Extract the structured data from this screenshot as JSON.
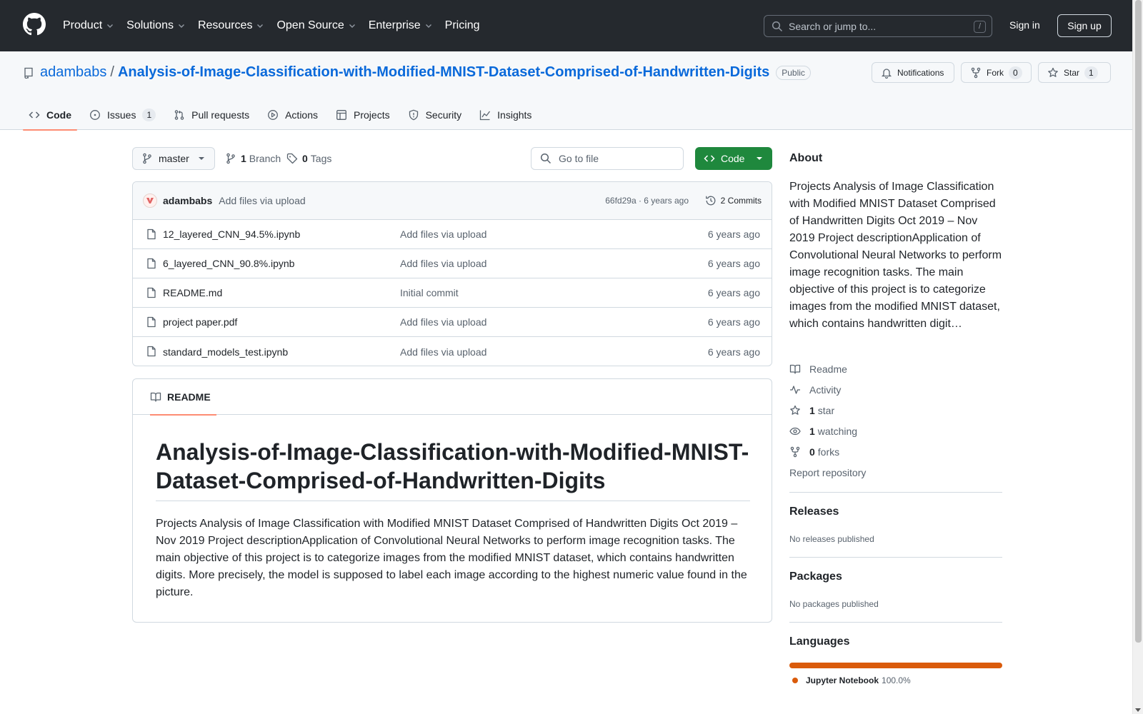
{
  "nav": {
    "items": [
      "Product",
      "Solutions",
      "Resources",
      "Open Source",
      "Enterprise",
      "Pricing"
    ],
    "search_placeholder": "Search or jump to...",
    "search_shortcut": "/",
    "sign_in": "Sign in",
    "sign_up": "Sign up"
  },
  "repo": {
    "owner": "adambabs",
    "separator": "/",
    "name": "Analysis-of-Image-Classification-with-Modified-MNIST-Dataset-Comprised-of-Handwritten-Digits",
    "visibility": "Public",
    "notifications_label": "Notifications",
    "fork_label": "Fork",
    "fork_count": "0",
    "star_label": "Star",
    "star_count": "1"
  },
  "tabs": [
    {
      "label": "Code",
      "icon": "code-icon",
      "active": true
    },
    {
      "label": "Issues",
      "icon": "issue-opened-icon",
      "count": "1"
    },
    {
      "label": "Pull requests",
      "icon": "git-pull-request-icon"
    },
    {
      "label": "Actions",
      "icon": "play-icon"
    },
    {
      "label": "Projects",
      "icon": "table-icon"
    },
    {
      "label": "Security",
      "icon": "shield-icon"
    },
    {
      "label": "Insights",
      "icon": "graph-icon"
    }
  ],
  "toolbar": {
    "branch": "master",
    "branch_count": "1",
    "branch_label": "Branch",
    "tag_count": "0",
    "tag_label": "Tags",
    "go_to_file": "Go to file",
    "code_button": "Code"
  },
  "latest_commit": {
    "author": "adambabs",
    "message": "Add files via upload",
    "meta": "66fd29a · 6 years ago",
    "commits_label": "2 Commits"
  },
  "files": [
    {
      "name": "12_layered_CNN_94.5%.ipynb",
      "message": "Add files via upload",
      "age": "6 years ago"
    },
    {
      "name": "6_layered_CNN_90.8%.ipynb",
      "message": "Add files via upload",
      "age": "6 years ago"
    },
    {
      "name": "README.md",
      "message": "Initial commit",
      "age": "6 years ago"
    },
    {
      "name": "project paper.pdf",
      "message": "Add files via upload",
      "age": "6 years ago"
    },
    {
      "name": "standard_models_test.ipynb",
      "message": "Add files via upload",
      "age": "6 years ago"
    }
  ],
  "readme": {
    "tab_label": "README",
    "heading": "Analysis-of-Image-Classification-with-Modified-MNIST-Dataset-Comprised-of-Handwritten-Digits",
    "body": "Projects Analysis of Image Classification with Modified MNIST Dataset Comprised of Handwritten Digits Oct 2019 – Nov 2019 Project descriptionApplication of Convolutional Neural Networks to perform image recognition tasks. The main objective of this project is to categorize images from the modified MNIST dataset, which contains handwritten digits. More precisely, the model is supposed to label each image according to the highest numeric value found in the picture."
  },
  "about": {
    "title": "About",
    "description": "Projects Analysis of Image Classification with Modified MNIST Dataset Comprised of Handwritten Digits Oct 2019 – Nov 2019 Project descriptionApplication of Convolutional Neural Networks to perform image recognition tasks. The main objective of this project is to categorize images from the modified MNIST dataset, which contains handwritten digit…",
    "readme_label": "Readme",
    "activity_label": "Activity",
    "stars_count": "1",
    "stars_label": "star",
    "watching_count": "1",
    "watching_label": "watching",
    "forks_count": "0",
    "forks_label": "forks",
    "report_label": "Report repository"
  },
  "releases": {
    "title": "Releases",
    "text": "No releases published"
  },
  "packages": {
    "title": "Packages",
    "text": "No packages published"
  },
  "languages": {
    "title": "Languages",
    "items": [
      {
        "name": "Jupyter Notebook",
        "percent": "100.0%",
        "color": "#da5b0b"
      }
    ]
  },
  "colors": {
    "header_bg": "#25292e",
    "link": "#0969da",
    "code_button": "#1f883d",
    "tab_underline": "#fd8c73"
  }
}
